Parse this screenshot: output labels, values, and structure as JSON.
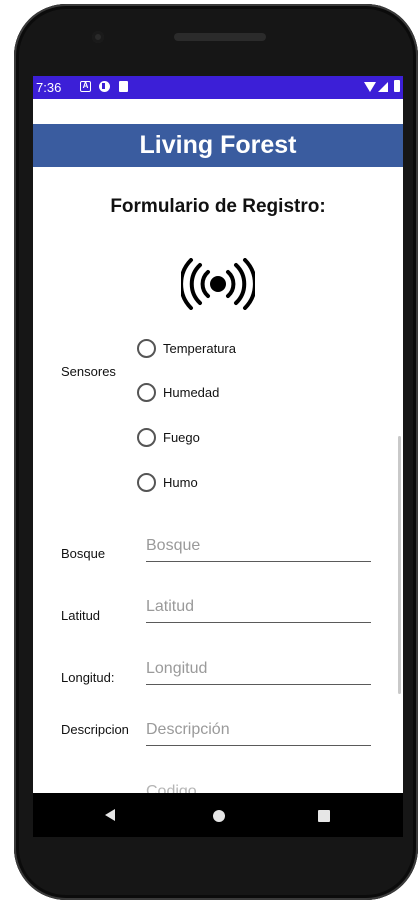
{
  "status_bar": {
    "time": "7:36",
    "icons": [
      "a-badge-icon",
      "p-icon",
      "sd-card-icon",
      "wifi-icon",
      "signal-icon",
      "battery-icon"
    ],
    "background_color": "#3c1fd7"
  },
  "app_bar": {
    "title": "Living Forest",
    "background_color": "#3a5c9f"
  },
  "form": {
    "title": "Formulario de Registro:",
    "sensor_icon": "wireless-sensor-icon",
    "sensors_label": "Sensores",
    "sensor_options": [
      {
        "label": "Temperatura",
        "checked": false
      },
      {
        "label": "Humedad",
        "checked": false
      },
      {
        "label": "Fuego",
        "checked": false
      },
      {
        "label": "Humo",
        "checked": false
      }
    ],
    "fields": {
      "bosque": {
        "label": "Bosque",
        "placeholder": "Bosque",
        "value": ""
      },
      "latitud": {
        "label": "Latitud",
        "placeholder": "Latitud",
        "value": ""
      },
      "longitud": {
        "label": "Longitud:",
        "placeholder": "Longitud",
        "value": ""
      },
      "descripcion": {
        "label": "Descripcion",
        "placeholder": "Descripción",
        "value": ""
      },
      "codigo": {
        "placeholder": "Codigo"
      }
    }
  },
  "nav_bar": {
    "icons": [
      "back-icon",
      "home-icon",
      "recent-apps-icon"
    ]
  }
}
